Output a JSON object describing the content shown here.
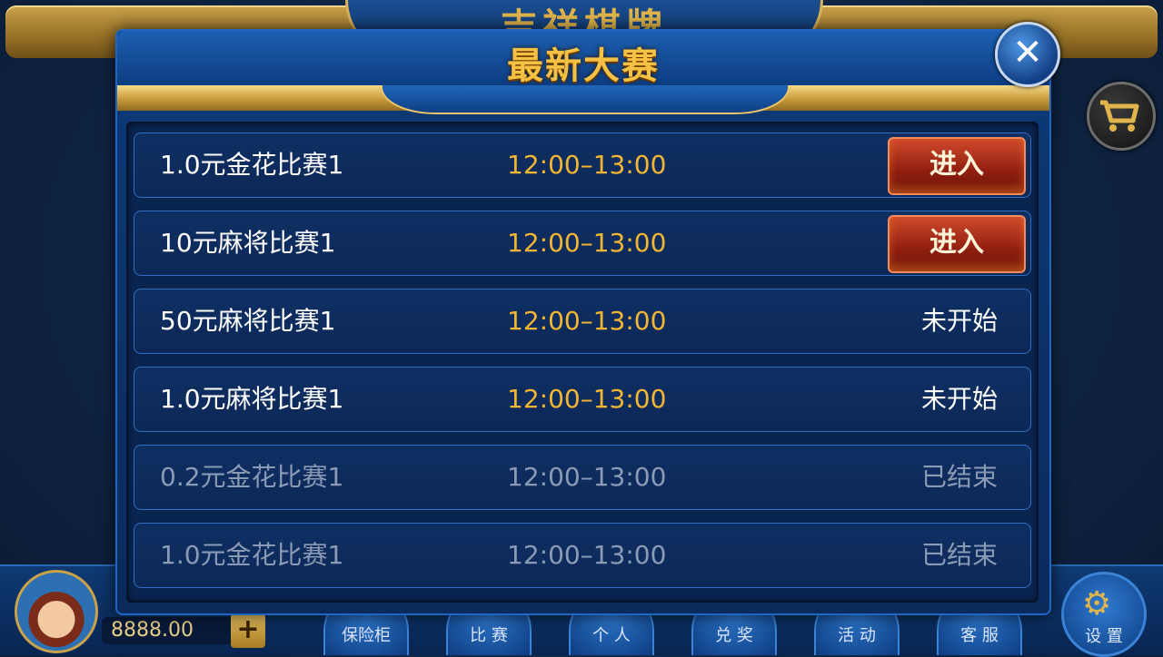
{
  "lobby": {
    "title_partial": "吉祥棋牌",
    "balance": "8888.00",
    "plus_label": "+",
    "nav": [
      {
        "label": "保险柜"
      },
      {
        "label": "比 赛"
      },
      {
        "label": "个 人"
      },
      {
        "label": "兑 奖"
      },
      {
        "label": "活 动"
      },
      {
        "label": "客 服"
      }
    ],
    "settings_label": "设 置"
  },
  "modal": {
    "title": "最新大赛",
    "close_icon": "✕",
    "rows": [
      {
        "name": "1.0元金花比赛1",
        "time": "12:00–13:00",
        "action": "进入",
        "state": "open"
      },
      {
        "name": "10元麻将比赛1",
        "time": "12:00–13:00",
        "action": "进入",
        "state": "open"
      },
      {
        "name": "50元麻将比赛1",
        "time": "12:00–13:00",
        "status": "未开始",
        "state": "pending"
      },
      {
        "name": "1.0元麻将比赛1",
        "time": "12:00–13:00",
        "status": "未开始",
        "state": "pending"
      },
      {
        "name": "0.2元金花比赛1",
        "time": "12:00–13:00",
        "status": "已结束",
        "state": "ended"
      },
      {
        "name": "1.0元金花比赛1",
        "time": "12:00–13:00",
        "status": "已结束",
        "state": "ended"
      }
    ]
  },
  "colors": {
    "time_text": "#f2b632",
    "ended_text": "#8b9bb5",
    "title_gold": "#f5c144",
    "enter_button": "#b03a1e"
  }
}
